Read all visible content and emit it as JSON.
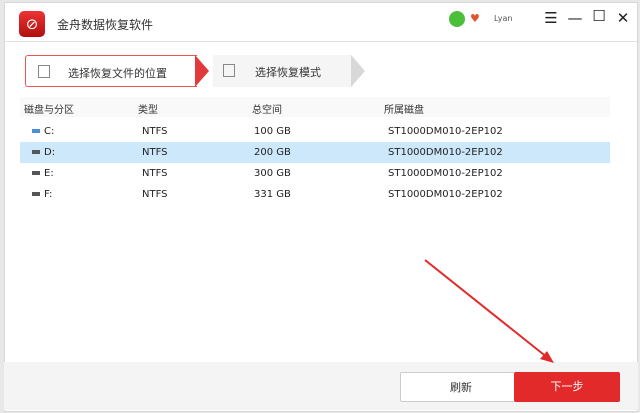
{
  "app": {
    "title": "金舟数据恢复软件",
    "user": "Lyan"
  },
  "steps": [
    {
      "label": "选择恢复文件的位置",
      "active": true
    },
    {
      "label": "选择恢复模式",
      "active": false
    }
  ],
  "table": {
    "headers": [
      "磁盘与分区",
      "类型",
      "总空间",
      "所属磁盘"
    ],
    "rows": [
      {
        "name": "C:",
        "type": "NTFS",
        "size": "100 GB",
        "disk": "ST1000DM010-2EP102",
        "selected": false
      },
      {
        "name": "D:",
        "type": "NTFS",
        "size": "200 GB",
        "disk": "ST1000DM010-2EP102",
        "selected": true
      },
      {
        "name": "E:",
        "type": "NTFS",
        "size": "300 GB",
        "disk": "ST1000DM010-2EP102",
        "selected": false
      },
      {
        "name": "F:",
        "type": "NTFS",
        "size": "331 GB",
        "disk": "ST1000DM010-2EP102",
        "selected": false
      }
    ]
  },
  "buttons": {
    "refresh": "刷新",
    "next": "下一步"
  },
  "colors": {
    "accent": "#e32a2a",
    "selection": "#cde8fb"
  }
}
